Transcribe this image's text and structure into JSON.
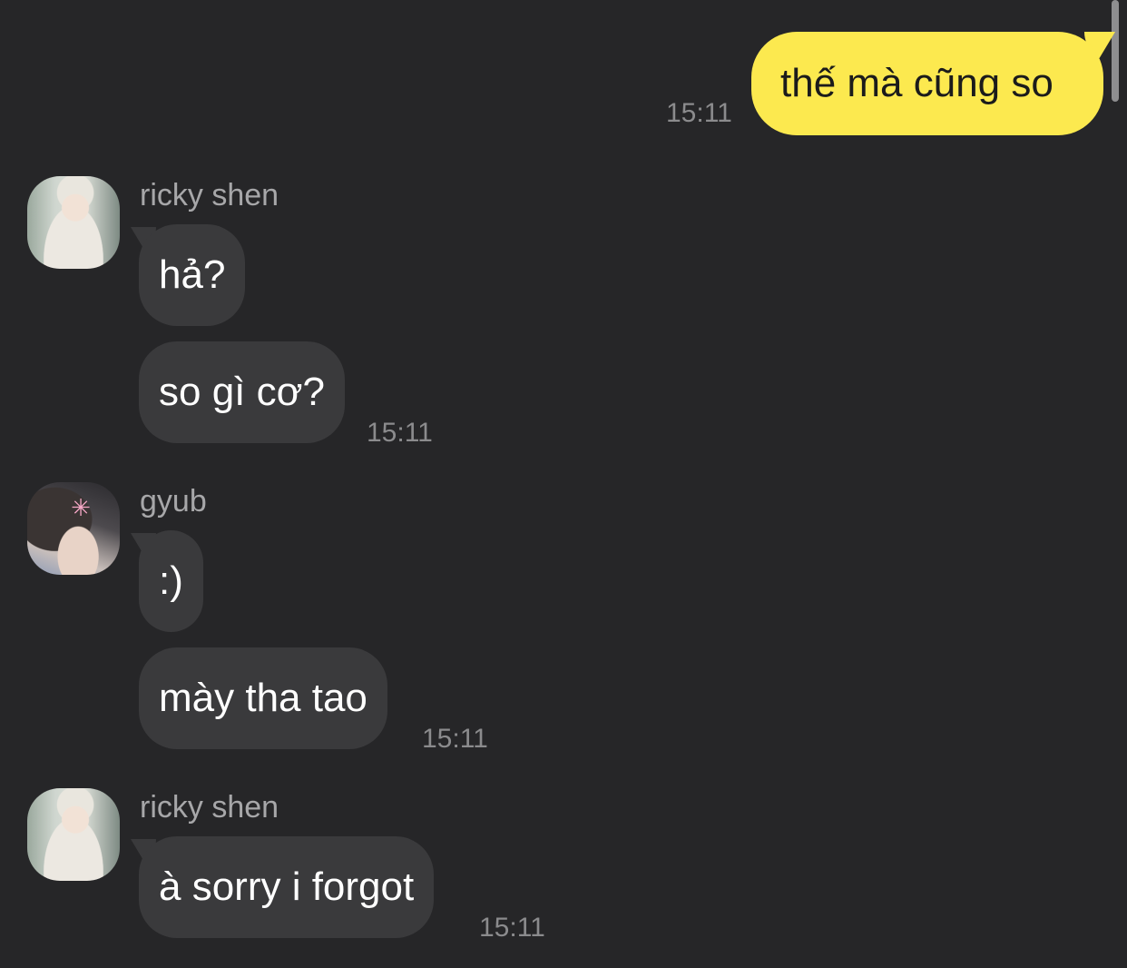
{
  "colors": {
    "background": "#262628",
    "outgoing_bubble": "#fce94f",
    "incoming_bubble": "#3a3a3c",
    "timestamp": "#8b8b8d",
    "sender_name": "#a7a7a9"
  },
  "outgoing": {
    "text": "thế mà cũng so",
    "time": "15:11"
  },
  "groups": [
    {
      "sender": "ricky shen",
      "avatar": "avatar-photo",
      "messages": [
        "hả?",
        "so gì cơ?"
      ],
      "time": "15:11"
    },
    {
      "sender": "gyub",
      "avatar": "avatar-photo",
      "messages": [
        ":)",
        "mày tha tao"
      ],
      "time": "15:11"
    },
    {
      "sender": "ricky shen",
      "avatar": "avatar-photo",
      "messages": [
        "à sorry i forgot"
      ],
      "time": "15:11"
    }
  ]
}
